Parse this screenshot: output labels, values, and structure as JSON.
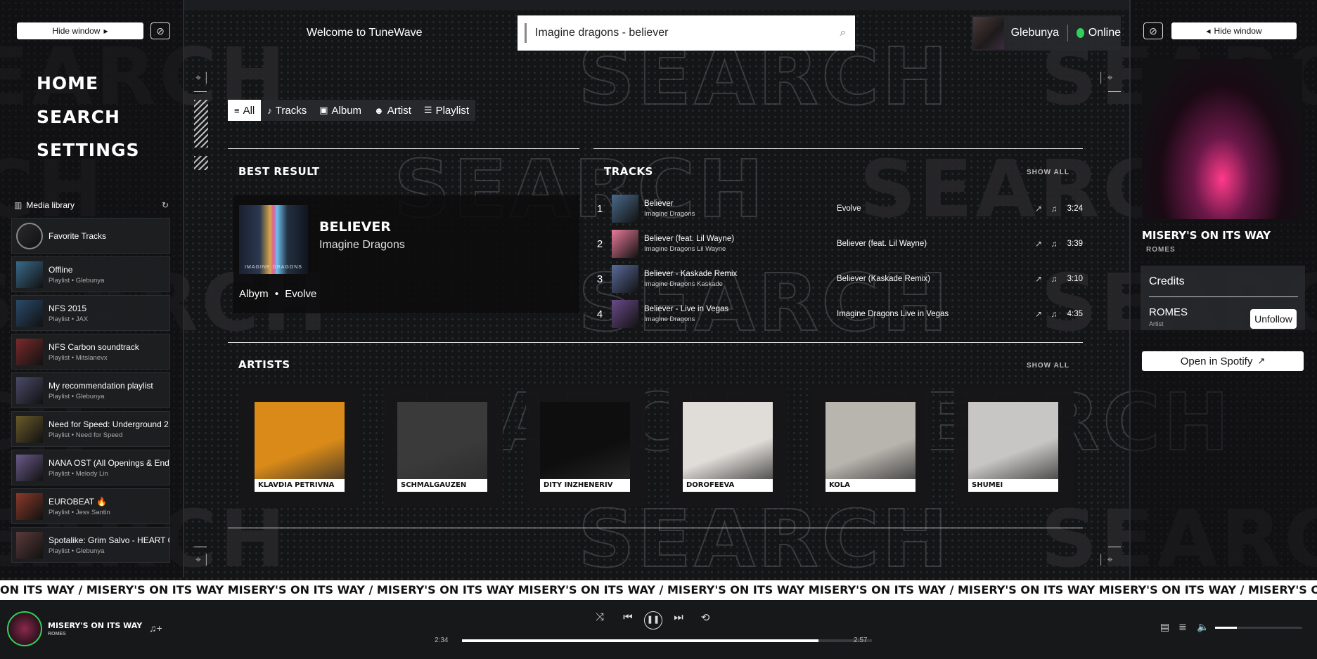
{
  "app": {
    "welcome": "Welcome to TuneWave",
    "bg_word": "SEARCH"
  },
  "left_panel": {
    "hide_label": "Hide window",
    "nav": [
      {
        "label": "HOME"
      },
      {
        "label": "SEARCH"
      },
      {
        "label": "SETTINGS"
      }
    ],
    "library_title": "Media library",
    "library": [
      {
        "title": "Favorite Tracks",
        "sub": "",
        "color": "#2a2a2e"
      },
      {
        "title": "Offline",
        "sub": "Playlist  •  Glebunya",
        "color": "#3a6a8a"
      },
      {
        "title": "NFS 2015",
        "sub": "Playlist  •  JAX",
        "color": "#2a4a6a"
      },
      {
        "title": "NFS Carbon soundtrack",
        "sub": "Playlist  •  Mitslanevx",
        "color": "#7a2a2a"
      },
      {
        "title": "My recommendation playlist",
        "sub": "Playlist  •  Glebunya",
        "color": "#4a4a6a"
      },
      {
        "title": "Need for Speed: Underground 2",
        "sub": "Playlist  •  Need for Speed",
        "color": "#6a5a2a"
      },
      {
        "title": "NANA OST (All Openings & Endings)",
        "sub": "Playlist  •  Melody Lin",
        "color": "#6a5a8a"
      },
      {
        "title": "EUROBEAT 🔥",
        "sub": "Playlist  •  Jess Santin",
        "color": "#8a3a2a"
      },
      {
        "title": "Spotalike: Grim Salvo - HEART OF DAR",
        "sub": "Playlist  •  Glebunya",
        "color": "#5a3a3a"
      }
    ]
  },
  "search": {
    "value": "Imagine dragons - believer"
  },
  "user": {
    "name": "Glebunya",
    "status": "Online"
  },
  "filters": [
    {
      "label": "All",
      "icon": "lines-icon"
    },
    {
      "label": "Tracks",
      "icon": "note-icon"
    },
    {
      "label": "Album",
      "icon": "album-icon"
    },
    {
      "label": "Artist",
      "icon": "person-icon"
    },
    {
      "label": "Playlist",
      "icon": "list-icon"
    }
  ],
  "best_result": {
    "heading": "BEST RESULT",
    "title": "BELIEVER",
    "artist": "Imagine Dragons",
    "meta_type": "Albym",
    "meta_album": "Evolve",
    "cover_text": "IMAGINE DRAGONS"
  },
  "tracks": {
    "heading": "TRACKS",
    "show_all": "SHOW ALL",
    "items": [
      {
        "num": "1",
        "title": "Believer",
        "artist": "Imagine Dragons",
        "album": "Evolve",
        "duration": "3:24",
        "color": "#4a6a8a"
      },
      {
        "num": "2",
        "title": "Believer (feat. Lil Wayne)",
        "artist": "Imagine Dragons  Lil Wayne",
        "album": "Believer (feat. Lil Wayne)",
        "duration": "3:39",
        "color": "#e87a9a"
      },
      {
        "num": "3",
        "title": "Believer - Kaskade Remix",
        "artist": "Imagine Dragons  Kaskade",
        "album": "Believer (Kaskade Remix)",
        "duration": "3:10",
        "color": "#5a6a9a"
      },
      {
        "num": "4",
        "title": "Believer - Live in Vegas",
        "artist": "Imagine Dragons",
        "album": "Imagine Dragons Live in Vegas",
        "duration": "4:35",
        "color": "#6a4a8a"
      }
    ]
  },
  "artists": {
    "heading": "ARTISTS",
    "show_all": "SHOW ALL",
    "items": [
      {
        "name": "KLAVDIA PETRIVNA",
        "color": "#d98a18"
      },
      {
        "name": "SCHMALGAUZEN",
        "color": "#3a3a3a"
      },
      {
        "name": "DITY INZHENERIV",
        "color": "#0e0e0e"
      },
      {
        "name": "DOROFEEVA",
        "color": "#e0dcd8"
      },
      {
        "name": "KOLA",
        "color": "#b8b4ae"
      },
      {
        "name": "SHUMEI",
        "color": "#c8c6c4"
      }
    ]
  },
  "right_panel": {
    "hide_label": "Hide window",
    "now_playing_title": "MISERY'S ON ITS WAY",
    "now_playing_artist": "ROMES",
    "credits_title": "Credits",
    "credit_artist": "ROMES",
    "credit_role": "Artist",
    "unfollow_label": "Unfollow",
    "spotify_label": "Open in Spotify"
  },
  "marquee": {
    "text": "ON ITS WAY / MISERY'S ON ITS WAY MISERY'S ON ITS WAY / MISERY'S ON ITS WAY MISERY'S ON ITS WAY / MISERY'S ON ITS WAY MISERY'S ON ITS WAY / MISERY'S ON ITS WAY MISERY'S ON ITS WAY / MISERY'S ON ITS WAY MISERY'S ON ITS WAY / MISERY'S ON ITS WAY"
  },
  "player": {
    "title": "MISERY'S ON ITS WAY",
    "artist": "ROMES",
    "elapsed": "2:34",
    "total": "2:57",
    "progress": 0.87,
    "volume": 0.25
  },
  "colors": {
    "accent_green": "#2fd15a",
    "background": "#141517"
  }
}
